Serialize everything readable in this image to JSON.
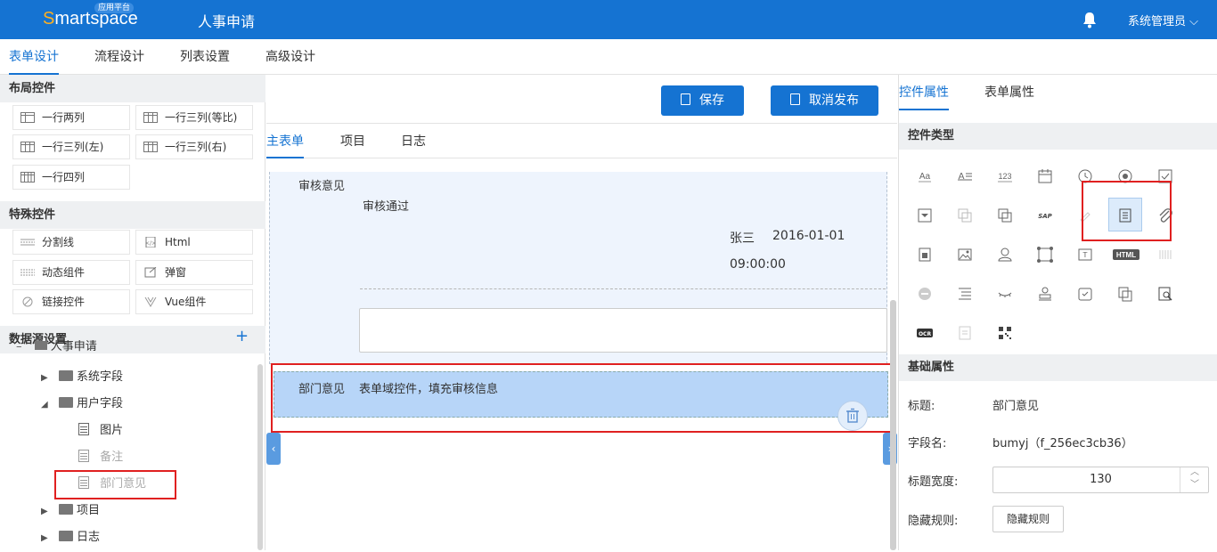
{
  "header": {
    "logo": "Smartspace",
    "logo_badge": "应用平台",
    "title": "人事申请",
    "user": "系统管理员"
  },
  "main_tabs": [
    {
      "label": "表单设计",
      "active": true
    },
    {
      "label": "流程设计",
      "active": false
    },
    {
      "label": "列表设置",
      "active": false
    },
    {
      "label": "高级设计",
      "active": false
    }
  ],
  "left": {
    "layout_title": "布局控件",
    "layout_controls": [
      "一行两列",
      "一行三列(等比)",
      "一行三列(左)",
      "一行三列(右)",
      "一行四列"
    ],
    "special_title": "特殊控件",
    "special_controls": [
      "分割线",
      "Html",
      "动态组件",
      "弹窗",
      "链接控件",
      "Vue组件"
    ],
    "datasource_title": "数据源设置",
    "tree": {
      "root": "人事申请",
      "items": [
        "系统字段",
        "用户字段",
        "图片",
        "备注",
        "部门意见",
        "项目",
        "日志"
      ]
    }
  },
  "center": {
    "save_label": "保存",
    "unpublish_label": "取消发布",
    "sub_tabs": [
      {
        "label": "主表单",
        "active": true
      },
      {
        "label": "项目",
        "active": false
      },
      {
        "label": "日志",
        "active": false
      }
    ],
    "review_label": "审核意见",
    "review_value": "审核通过",
    "reviewer": "张三",
    "review_date": "2016-01-01",
    "review_time": "09:00:00",
    "dept_label": "部门意见",
    "dept_hint": "表单域控件，填充审核信息"
  },
  "right": {
    "tabs": [
      {
        "label": "控件属性",
        "active": true
      },
      {
        "label": "表单属性",
        "active": false
      }
    ],
    "type_title": "控件类型",
    "html_icon_text": "HTML",
    "ocr_icon_text": "OCR",
    "sap_icon_text": "SAP",
    "basic_title": "基础属性",
    "props": {
      "title_label": "标题:",
      "title_value": "部门意见",
      "field_label": "字段名:",
      "field_value": "bumyj（f_256ec3cb36）",
      "width_label": "标题宽度:",
      "width_value": "130",
      "hide_label": "隐藏规则:",
      "hide_button": "隐藏规则"
    }
  },
  "colors": {
    "brand": "#1573d2",
    "highlight": "#e02020",
    "selected_field": "#b7d5f8"
  }
}
